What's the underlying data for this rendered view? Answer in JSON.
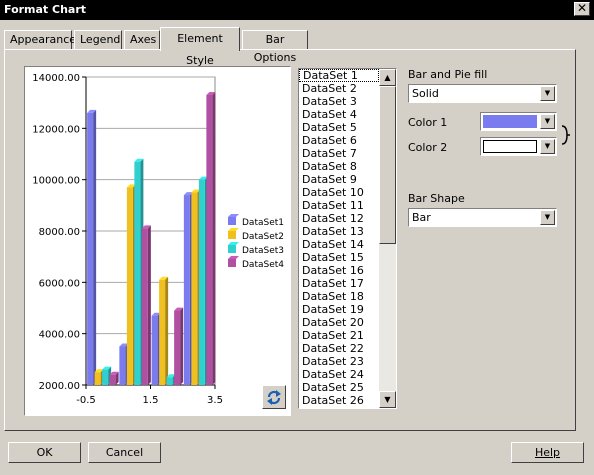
{
  "window": {
    "title": "Format Chart",
    "close_label": "✕"
  },
  "tabs": [
    {
      "label": "Appearance"
    },
    {
      "label": "Legend"
    },
    {
      "label": "Axes"
    },
    {
      "label": "Element Style"
    },
    {
      "label": "Bar Options"
    }
  ],
  "datasets": [
    "DataSet 1",
    "DataSet 2",
    "DataSet 3",
    "DataSet 4",
    "DataSet 5",
    "DataSet 6",
    "DataSet 7",
    "DataSet 8",
    "DataSet 9",
    "DataSet 10",
    "DataSet 11",
    "DataSet 12",
    "DataSet 13",
    "DataSet 14",
    "DataSet 15",
    "DataSet 16",
    "DataSet 17",
    "DataSet 18",
    "DataSet 19",
    "DataSet 20",
    "DataSet 21",
    "DataSet 22",
    "DataSet 23",
    "DataSet 24",
    "DataSet 25",
    "DataSet 26"
  ],
  "fill": {
    "label": "Bar and Pie fill",
    "value": "Solid"
  },
  "color1": {
    "label": "Color 1",
    "value": "#7b7bf0"
  },
  "color2": {
    "label": "Color 2",
    "value": "#ffffff"
  },
  "shape": {
    "label": "Bar Shape",
    "value": "Bar"
  },
  "buttons": {
    "ok": "OK",
    "cancel": "Cancel",
    "help": "Help"
  },
  "chart_data": {
    "type": "bar",
    "x_ticks": [
      "-0.5",
      "1.5",
      "3.5"
    ],
    "y_ticks": [
      "2000.00",
      "4000.00",
      "6000.00",
      "8000.00",
      "10000.00",
      "12000.00",
      "14000.00"
    ],
    "ylim": [
      2000,
      14000
    ],
    "grid": true,
    "legend_position": "right",
    "categories": [
      "0",
      "1",
      "2",
      "3"
    ],
    "series": [
      {
        "name": "DataSet1",
        "color": "#7b7bf0",
        "values": [
          12600,
          3500,
          4700,
          9400
        ]
      },
      {
        "name": "DataSet2",
        "color": "#f0c020",
        "values": [
          2500,
          9700,
          6100,
          9500
        ]
      },
      {
        "name": "DataSet3",
        "color": "#30d0d0",
        "values": [
          2600,
          10700,
          2300,
          10000
        ]
      },
      {
        "name": "DataSet4",
        "color": "#b050a0",
        "values": [
          2400,
          8100,
          4900,
          13300
        ]
      }
    ]
  }
}
